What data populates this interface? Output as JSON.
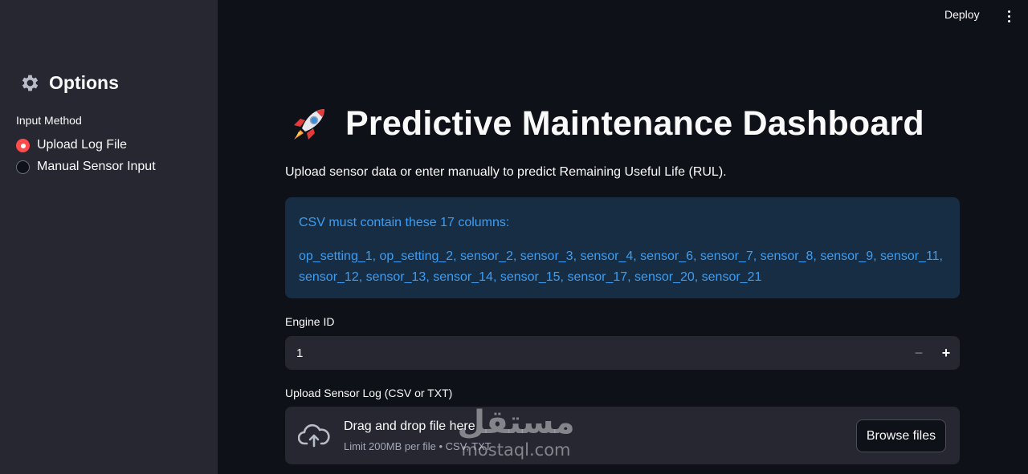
{
  "header": {
    "deploy_label": "Deploy",
    "menu_icon": "kebab-menu-icon"
  },
  "sidebar": {
    "title": "Options",
    "title_icon": "gear-icon",
    "input_method_label": "Input Method",
    "options": [
      {
        "label": "Upload Log File",
        "selected": true
      },
      {
        "label": "Manual Sensor Input",
        "selected": false
      }
    ]
  },
  "main": {
    "title": "Predictive Maintenance Dashboard",
    "title_icon": "rocket-icon",
    "subtitle": "Upload sensor data or enter manually to predict Remaining Useful Life (RUL).",
    "info": {
      "heading": "CSV must contain these 17 columns:",
      "columns_line1": "op_setting_1, op_setting_2, sensor_2, sensor_3, sensor_4, sensor_6, sensor_7, sensor_8, sensor_9, sensor_11,",
      "columns_line2": "sensor_12, sensor_13, sensor_14, sensor_15, sensor_17, sensor_20, sensor_21"
    },
    "engine_id": {
      "label": "Engine ID",
      "value": "1",
      "decrement": "−",
      "increment": "+"
    },
    "uploader": {
      "label": "Upload Sensor Log (CSV or TXT)",
      "drop_text": "Drag and drop file here",
      "limit_text": "Limit 200MB per file • CSV, TXT",
      "button_label": "Browse files"
    }
  },
  "watermark": {
    "arabic": "مستقل",
    "latin": "mostaql.com"
  },
  "colors": {
    "background": "#0e1117",
    "sidebar": "#262730",
    "accent": "#ff4b4b",
    "info_bg": "#172d43",
    "info_text": "#3d9df3"
  }
}
